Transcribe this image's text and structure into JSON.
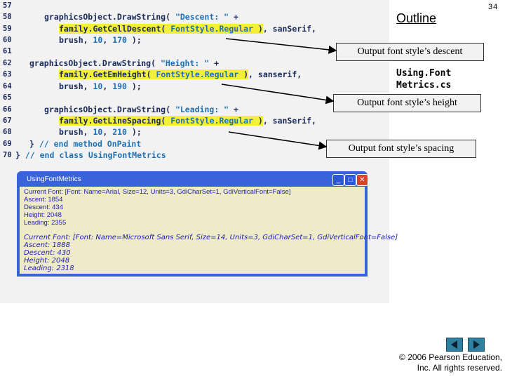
{
  "header": {
    "outline": "Outline",
    "page_number": "34",
    "filename_line1": "Using.Font",
    "filename_line2": "Metrics.cs"
  },
  "code": [
    {
      "ln": "57",
      "text": ""
    },
    {
      "ln": "58",
      "text": "      graphicsObject.DrawString( \"Descent: \" +"
    },
    {
      "ln": "59",
      "text": "        family.GetCellDescent( FontStyle.Regular ), sanSerif,"
    },
    {
      "ln": "60",
      "text": "        brush, 10, 170 );"
    },
    {
      "ln": "61",
      "text": ""
    },
    {
      "ln": "62",
      "text": "   graphicsObject.DrawString( \"Height: \" +"
    },
    {
      "ln": "63",
      "text": "        family.GetEmHeight( FontStyle.Regular ), sanserif,"
    },
    {
      "ln": "64",
      "text": "        brush, 10, 190 );"
    },
    {
      "ln": "65",
      "text": ""
    },
    {
      "ln": "66",
      "text": "      graphicsObject.DrawString( \"Leading: \" +"
    },
    {
      "ln": "67",
      "text": "        family.GetLineSpacing( FontStyle.Regular ), sanSerif,"
    },
    {
      "ln": "68",
      "text": "        brush, 10, 210 );"
    },
    {
      "ln": "69",
      "text": "   } // end method OnPaint"
    },
    {
      "ln": "70",
      "text": "} // end class UsingFontMetrics"
    }
  ],
  "callouts": {
    "descent": "Output font style’s descent",
    "height": "Output font style’s height",
    "spacing": "Output font style’s spacing"
  },
  "window": {
    "title": "UsingFontMetrics",
    "min": "_",
    "max": "□",
    "close": "✕",
    "block1": [
      "Current Font: [Font: Name=Arial, Size=12, Units=3, GdiCharSet=1, GdiVerticalFont=False]",
      "Ascent: 1854",
      "Descent: 434",
      "Height: 2048",
      "Leading: 2355"
    ],
    "block2": [
      "Current Font: [Font: Name=Microsoft Sans Serif, Size=14, Units=3, GdiCharSet=1, GdiVerticalFont=False]",
      "Ascent: 1888",
      "Descent: 430",
      "Height: 2048",
      "Leading: 2318"
    ]
  },
  "footer": {
    "copyright_line1": "© 2006 Pearson Education,",
    "copyright_line2": "Inc.  All rights reserved.",
    "prev_label": "previous",
    "next_label": "next"
  },
  "colors": {
    "highlight": "#f4ef3a",
    "title_bar": "#3b63d9",
    "client_bg": "#efebc8",
    "output_text": "#1c1cb0"
  }
}
